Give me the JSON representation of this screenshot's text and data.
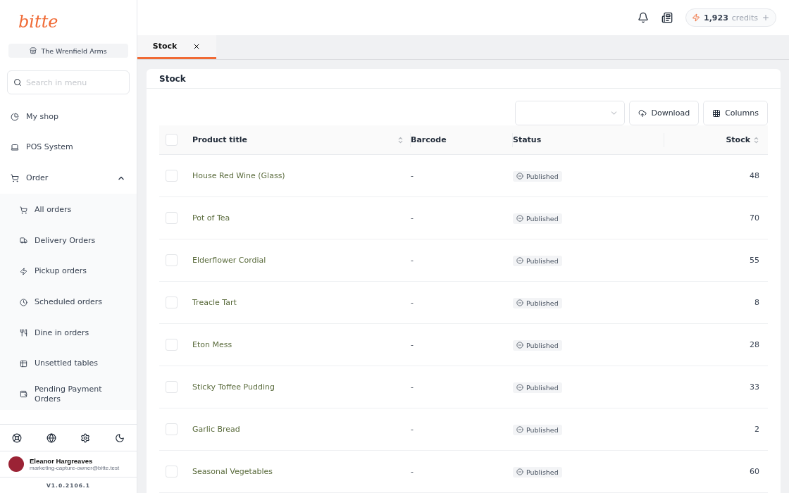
{
  "brand": {
    "logo": "bitte"
  },
  "store": {
    "name": "The Wrenfield Arms"
  },
  "menu_search": {
    "placeholder": "Search in menu"
  },
  "menu": [
    {
      "label": "My shop"
    },
    {
      "label": "POS System"
    },
    {
      "label": "Order",
      "expanded": true,
      "children": [
        {
          "label": "All orders"
        },
        {
          "label": "Delivery Orders"
        },
        {
          "label": "Pickup orders"
        },
        {
          "label": "Scheduled orders"
        },
        {
          "label": "Dine in orders"
        },
        {
          "label": "Unsettled tables"
        },
        {
          "label": "Pending Payment Orders"
        }
      ]
    }
  ],
  "user": {
    "name": "Eleanor Hargreaves",
    "email": "marketing-capture-owner@bitte.test"
  },
  "version": "V1.0.2106.1",
  "header": {
    "credits": "1,923",
    "credits_label": "credits"
  },
  "tabs": [
    {
      "label": "Stock",
      "selected": true
    }
  ],
  "page": {
    "title": "Stock",
    "buttons": [
      "Download",
      "Columns"
    ]
  },
  "table": {
    "select_all": {
      "checked": false
    },
    "columns": [
      {
        "label": "Product title",
        "sortable": true
      },
      {
        "label": "Barcode",
        "sortable": false
      },
      {
        "label": "Status",
        "sortable": false
      },
      {
        "label": "Stock",
        "sortable": true
      }
    ],
    "rows": [
      {
        "title": "House Red Wine (Glass)",
        "barcode": "-",
        "status": "Published",
        "stock": "48",
        "checked": false
      },
      {
        "title": "Pot of Tea",
        "barcode": "-",
        "status": "Published",
        "stock": "70",
        "checked": false
      },
      {
        "title": "Elderflower Cordial",
        "barcode": "-",
        "status": "Published",
        "stock": "55",
        "checked": false
      },
      {
        "title": "Treacle Tart",
        "barcode": "-",
        "status": "Published",
        "stock": "8",
        "checked": false
      },
      {
        "title": "Eton Mess",
        "barcode": "-",
        "status": "Published",
        "stock": "28",
        "checked": false
      },
      {
        "title": "Sticky Toffee Pudding",
        "barcode": "-",
        "status": "Published",
        "stock": "33",
        "checked": false
      },
      {
        "title": "Garlic Bread",
        "barcode": "-",
        "status": "Published",
        "stock": "2",
        "checked": false
      },
      {
        "title": "Seasonal Vegetables",
        "barcode": "-",
        "status": "Published",
        "stock": "60",
        "checked": false
      }
    ]
  }
}
